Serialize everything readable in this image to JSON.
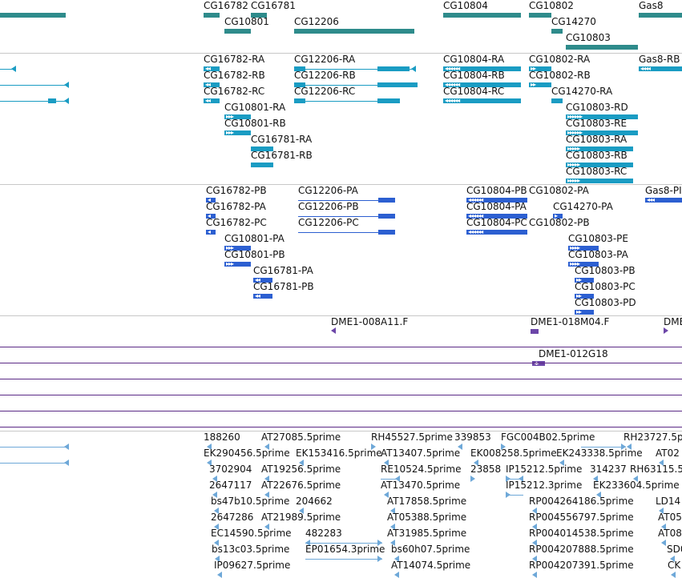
{
  "colors": {
    "gene": "#2e8b8b",
    "transcript": "#1a9cc3",
    "protein": "#2c5fd1",
    "clone": "#6c46a8",
    "clone_line": "#5b2a86",
    "est": "#6ea8d8",
    "separator": "#c8c8c8"
  },
  "genes": [
    {
      "label": "CG16782"
    },
    {
      "label": "CG16781"
    },
    {
      "label": "CG10801"
    },
    {
      "label": "CG12206"
    },
    {
      "label": "CG10804"
    },
    {
      "label": "CG10802"
    },
    {
      "label": "CG14270"
    },
    {
      "label": "CG10803"
    },
    {
      "label": "Gas8"
    }
  ],
  "transcripts": [
    {
      "label": "CG16782-RA"
    },
    {
      "label": "CG16782-RB"
    },
    {
      "label": "CG16782-RC"
    },
    {
      "label": "CG10801-RA"
    },
    {
      "label": "CG10801-RB"
    },
    {
      "label": "CG16781-RA"
    },
    {
      "label": "CG16781-RB"
    },
    {
      "label": "CG12206-RA"
    },
    {
      "label": "CG12206-RB"
    },
    {
      "label": "CG12206-RC"
    },
    {
      "label": "CG10804-RA"
    },
    {
      "label": "CG10804-RB"
    },
    {
      "label": "CG10804-RC"
    },
    {
      "label": "CG10802-RA"
    },
    {
      "label": "CG10802-RB"
    },
    {
      "label": "CG14270-RA"
    },
    {
      "label": "CG10803-RD"
    },
    {
      "label": "CG10803-RE"
    },
    {
      "label": "CG10803-RA"
    },
    {
      "label": "CG10803-RB"
    },
    {
      "label": "CG10803-RC"
    },
    {
      "label": "Gas8-RB"
    }
  ],
  "proteins": [
    {
      "label": "CG16782-PB"
    },
    {
      "label": "CG16782-PA"
    },
    {
      "label": "CG16782-PC"
    },
    {
      "label": "CG10801-PA"
    },
    {
      "label": "CG10801-PB"
    },
    {
      "label": "CG16781-PA"
    },
    {
      "label": "CG16781-PB"
    },
    {
      "label": "CG12206-PA"
    },
    {
      "label": "CG12206-PB"
    },
    {
      "label": "CG12206-PC"
    },
    {
      "label": "CG10804-PB"
    },
    {
      "label": "CG10804-PA"
    },
    {
      "label": "CG10804-PC"
    },
    {
      "label": "CG10802-PA"
    },
    {
      "label": "CG10802-PB"
    },
    {
      "label": "CG14270-PA"
    },
    {
      "label": "CG10803-PE"
    },
    {
      "label": "CG10803-PA"
    },
    {
      "label": "CG10803-PB"
    },
    {
      "label": "CG10803-PC"
    },
    {
      "label": "CG10803-PD"
    },
    {
      "label": "Gas8-PI"
    }
  ],
  "clones": [
    {
      "label": "DME1-008A11.F"
    },
    {
      "label": "DME1-018M04.F"
    },
    {
      "label": "DME"
    },
    {
      "label": "DME1-012G18"
    }
  ],
  "ests": [
    {
      "label": "188260"
    },
    {
      "label": "AT27085.5prime"
    },
    {
      "label": "RH45527.5prime"
    },
    {
      "label": "339853"
    },
    {
      "label": "FGC004B02.5prime"
    },
    {
      "label": "RH23727.5p"
    },
    {
      "label": "EK290456.5prime"
    },
    {
      "label": "EK153416.5prime"
    },
    {
      "label": "AT13407.5prime"
    },
    {
      "label": "EK008258.5prime"
    },
    {
      "label": "EK243338.5prime"
    },
    {
      "label": "AT02"
    },
    {
      "label": "3702904"
    },
    {
      "label": "AT19256.5prime"
    },
    {
      "label": "RE10524.5prime"
    },
    {
      "label": "23858"
    },
    {
      "label": "IP15212.5prime"
    },
    {
      "label": "314237"
    },
    {
      "label": "RH63115.5"
    },
    {
      "label": "2647117"
    },
    {
      "label": "AT22676.5prime"
    },
    {
      "label": "AT13470.5prime"
    },
    {
      "label": "IP15212.3prime"
    },
    {
      "label": "EK233604.5prime"
    },
    {
      "label": "bs47b10.5prime"
    },
    {
      "label": "204662"
    },
    {
      "label": "AT17858.5prime"
    },
    {
      "label": "RP004264186.5prime"
    },
    {
      "label": "LD14"
    },
    {
      "label": "2647286"
    },
    {
      "label": "AT21989.5prime"
    },
    {
      "label": "AT05388.5prime"
    },
    {
      "label": "RP004556797.5prime"
    },
    {
      "label": "AT05"
    },
    {
      "label": "EC14590.5prime"
    },
    {
      "label": "482283"
    },
    {
      "label": "AT31985.5prime"
    },
    {
      "label": "RP004014538.5prime"
    },
    {
      "label": "AT08"
    },
    {
      "label": "bs13c03.5prime"
    },
    {
      "label": "EP01654.3prime"
    },
    {
      "label": "bs60h07.5prime"
    },
    {
      "label": "RP004207888.5prime"
    },
    {
      "label": "SD0"
    },
    {
      "label": "IP09627.5prime"
    },
    {
      "label": "AT14074.5prime"
    },
    {
      "label": "RP004207391.5prime"
    },
    {
      "label": "CK"
    }
  ]
}
